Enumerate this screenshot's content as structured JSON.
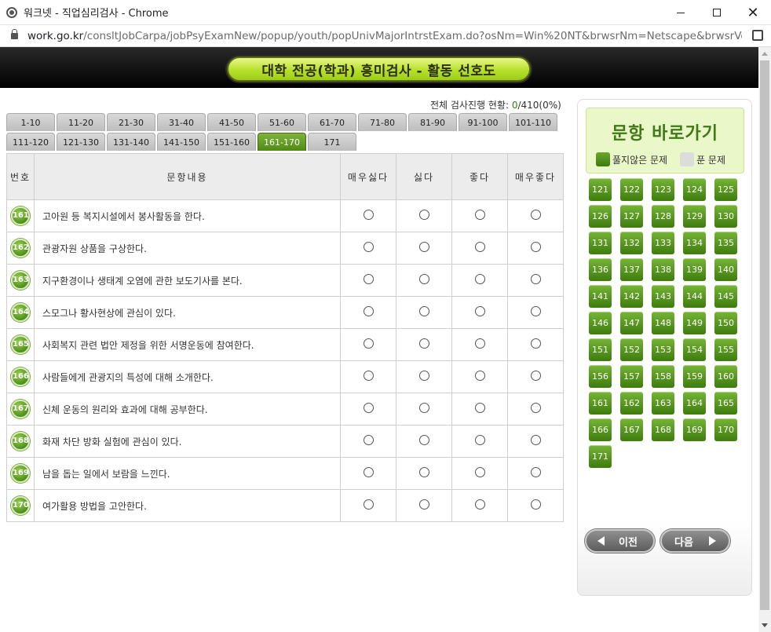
{
  "window": {
    "title": "워크넷 - 직업심리검사 - Chrome",
    "url_host": "work.go.kr",
    "url_path": "/consltJobCarpa/jobPsyExamNew/popup/youth/popUnivMajorIntrstExam.do?osNm=Win%20NT&brwsrNm=Netscape&brwsrVer=5..."
  },
  "header": {
    "title": "대학 전공(학과) 흥미검사 - 활동 선호도"
  },
  "progress": {
    "label": "전체 검사진행 현황: ",
    "done": "0",
    "total": "/410(0%)"
  },
  "tabs": {
    "row1": [
      "1-10",
      "11-20",
      "21-30",
      "31-40",
      "41-50",
      "51-60",
      "61-70",
      "71-80",
      "81-90",
      "91-100",
      "101-110"
    ],
    "row2": [
      "111-120",
      "121-130",
      "131-140",
      "141-150",
      "151-160",
      "161-170",
      "171"
    ],
    "active": "161-170"
  },
  "table": {
    "headers": {
      "num": "번호",
      "content": "문항내용",
      "opt1": "매우싫다",
      "opt2": "싫다",
      "opt3": "좋다",
      "opt4": "매우좋다"
    },
    "rows": [
      {
        "num": "161",
        "text": "고아원 등 복지시설에서 봉사활동을 한다."
      },
      {
        "num": "162",
        "text": "관광자원 상품을 구상한다."
      },
      {
        "num": "163",
        "text": "지구환경이나 생태계 오염에 관한 보도기사를 본다."
      },
      {
        "num": "164",
        "text": "스모그나 황사현상에 관심이 있다."
      },
      {
        "num": "165",
        "text": "사회복지 관련 법안 제정을 위한 서명운동에 참여한다."
      },
      {
        "num": "166",
        "text": "사람들에게 관광지의 특성에 대해 소개한다."
      },
      {
        "num": "167",
        "text": "신체 운동의 원리와 효과에 대해 공부한다."
      },
      {
        "num": "168",
        "text": "화재 차단 방화 실험에 관심이 있다."
      },
      {
        "num": "169",
        "text": "남을 돕는 일에서 보람을 느낀다."
      },
      {
        "num": "170",
        "text": "여가활용 방법을 고안한다."
      }
    ]
  },
  "side": {
    "title": "문항 바로가기",
    "legend_todo": "풀지않은 문제",
    "legend_done": "푼 문제",
    "items": [
      "121",
      "122",
      "123",
      "124",
      "125",
      "126",
      "127",
      "128",
      "129",
      "130",
      "131",
      "132",
      "133",
      "134",
      "135",
      "136",
      "137",
      "138",
      "139",
      "140",
      "141",
      "142",
      "143",
      "144",
      "145",
      "146",
      "147",
      "148",
      "149",
      "150",
      "151",
      "152",
      "153",
      "154",
      "155",
      "156",
      "157",
      "158",
      "159",
      "160",
      "161",
      "162",
      "163",
      "164",
      "165",
      "166",
      "167",
      "168",
      "169",
      "170",
      "171"
    ],
    "prev_label": "이전",
    "next_label": "다음"
  }
}
